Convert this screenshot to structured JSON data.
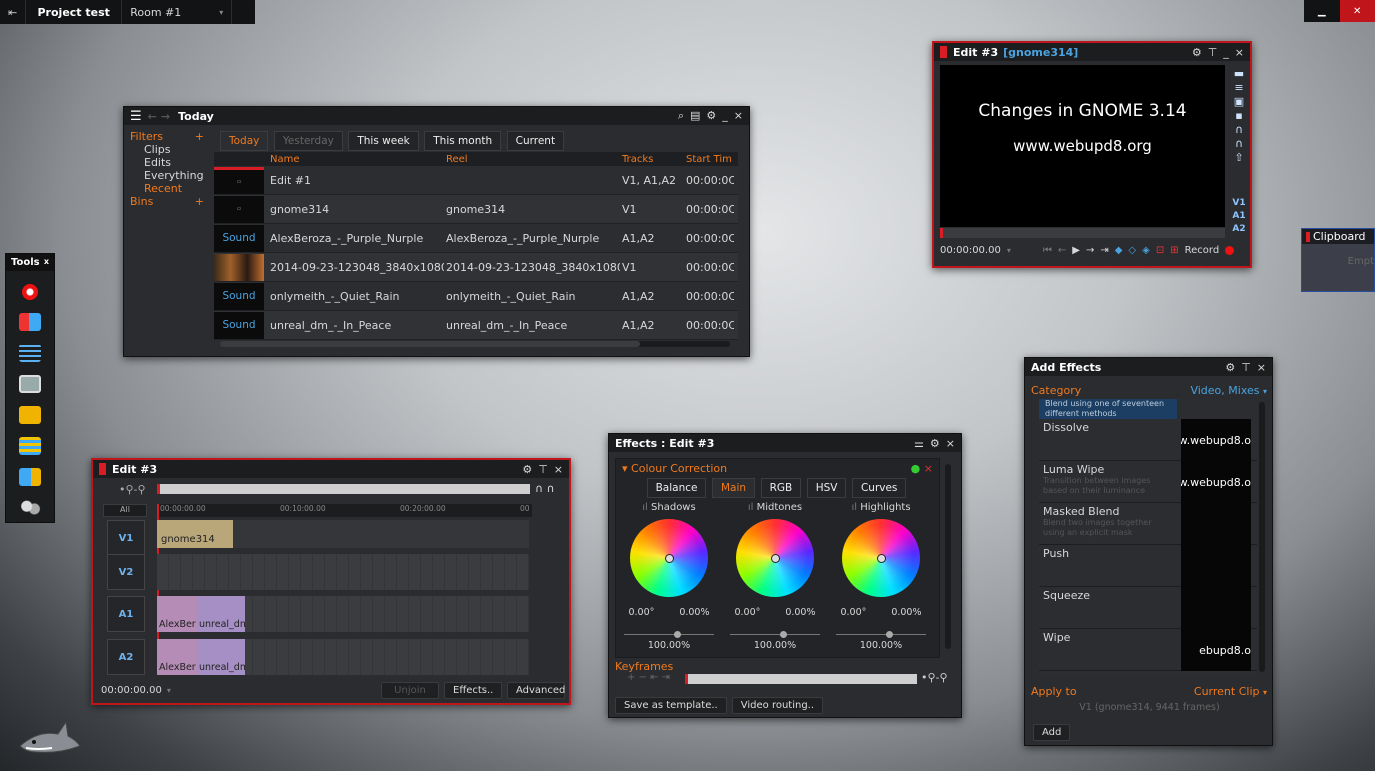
{
  "topbar": {
    "project": "Project test",
    "room": "Room #1"
  },
  "tools": {
    "title": "Tools"
  },
  "browser": {
    "title": "Today",
    "filters_label": "Filters",
    "filters": [
      "Clips",
      "Edits",
      "Everything",
      "Recent"
    ],
    "bins_label": "Bins",
    "tabs": [
      "Today",
      "Yesterday",
      "This week",
      "This month",
      "Current"
    ],
    "columns": [
      "Name",
      "Reel",
      "Tracks",
      "Start Tim"
    ],
    "rows": [
      {
        "thumb": "",
        "name": "Edit #1",
        "reel": "",
        "tracks": "V1, A1,A2",
        "start": "00:00:0C"
      },
      {
        "thumb": "",
        "name": "gnome314",
        "reel": "gnome314",
        "tracks": "V1",
        "start": "00:00:0C"
      },
      {
        "thumb": "Sound",
        "name": "AlexBeroza_-_Purple_Nurple",
        "reel": "AlexBeroza_-_Purple_Nurple",
        "tracks": "A1,A2",
        "start": "00:00:0C"
      },
      {
        "thumb": "",
        "name": "2014-09-23-123048_3840x1080_scrot",
        "reel": "2014-09-23-123048_3840x1080_scrot",
        "tracks": "V1",
        "start": "00:00:0C"
      },
      {
        "thumb": "Sound",
        "name": "onlymeith_-_Quiet_Rain",
        "reel": "onlymeith_-_Quiet_Rain",
        "tracks": "A1,A2",
        "start": "00:00:0C"
      },
      {
        "thumb": "Sound",
        "name": "unreal_dm_-_In_Peace",
        "reel": "unreal_dm_-_In_Peace",
        "tracks": "A1,A2",
        "start": "00:00:0C"
      }
    ]
  },
  "viewer": {
    "title": "Edit #3",
    "subtitle": "[gnome314]",
    "line1": "Changes in GNOME 3.14",
    "line2": "www.webupd8.org",
    "tracks": [
      "V1",
      "A1",
      "A2"
    ],
    "timecode": "00:00:00.00",
    "record": "Record"
  },
  "clipboard": {
    "title": "Clipboard",
    "empty": "Empt"
  },
  "timeline": {
    "title": "Edit #3",
    "all": "All",
    "ruler": [
      "00:00:00.00",
      "00:10:00.00",
      "00:20:00.00",
      "00"
    ],
    "tracks": [
      "V1",
      "V2",
      "A1",
      "A2"
    ],
    "clip_v1": "gnome314",
    "clip_a1a": "AlexBer",
    "clip_a1b": "unreal_dm",
    "clip_a2a": "AlexBer",
    "clip_a2b": "unreal_dm",
    "timecode": "00:00:00.00",
    "unjoin": "Unjoin",
    "effects": "Effects..",
    "advanced": "Advanced"
  },
  "effects": {
    "title": "Effects : Edit #3",
    "section": "Colour Correction",
    "tabs": [
      "Balance",
      "Main",
      "RGB",
      "HSV",
      "Curves"
    ],
    "wheels": [
      {
        "label": "Shadows",
        "angle": "0.00°",
        "pct": "0.00%",
        "level": "100.00%"
      },
      {
        "label": "Midtones",
        "angle": "0.00°",
        "pct": "0.00%",
        "level": "100.00%"
      },
      {
        "label": "Highlights",
        "angle": "0.00°",
        "pct": "0.00%",
        "level": "100.00%"
      }
    ],
    "keyframes": "Keyframes",
    "save_template": "Save as template..",
    "video_routing": "Video routing.."
  },
  "add_effects": {
    "title": "Add Effects",
    "category_label": "Category",
    "category_value": "Video, Mixes",
    "top_desc": "Blend using one of seventeen different methods",
    "items": [
      {
        "name": "Dissolve",
        "desc": "",
        "thumb": "ww.webupd8.o"
      },
      {
        "name": "Luma Wipe",
        "desc": "Transition between images based on their luminance",
        "thumb": "ww.webupd8.o"
      },
      {
        "name": "Masked Blend",
        "desc": "Blend two images together using an explicit mask",
        "thumb": ""
      },
      {
        "name": "Push",
        "desc": "",
        "thumb": ""
      },
      {
        "name": "Squeeze",
        "desc": "",
        "thumb": ""
      },
      {
        "name": "Wipe",
        "desc": "",
        "thumb": "ebupd8.o"
      }
    ],
    "apply_label": "Apply to",
    "apply_value": "Current Clip",
    "apply_detail": "V1 (gnome314, 9441 frames)",
    "add": "Add"
  }
}
